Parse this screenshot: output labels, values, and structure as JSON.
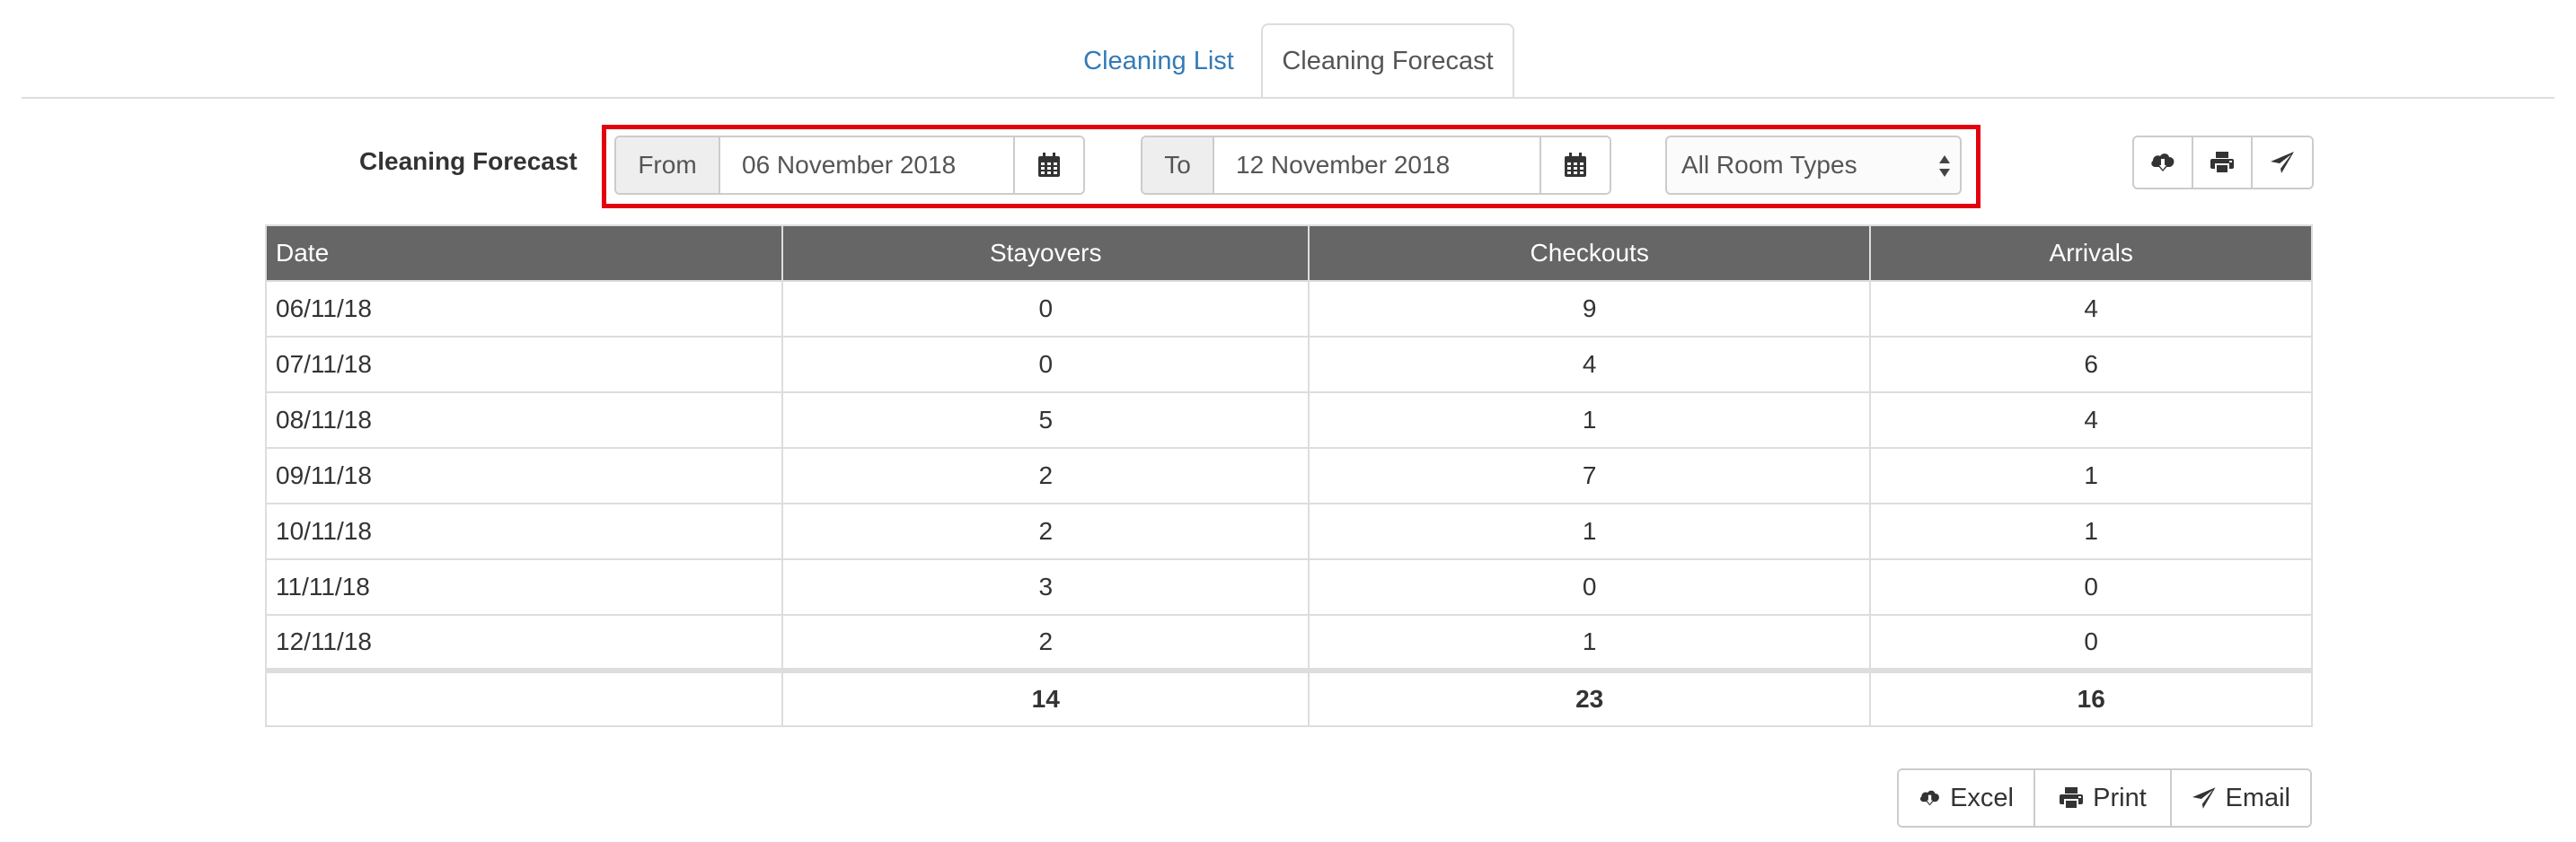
{
  "tabs": [
    {
      "label": "Cleaning List"
    },
    {
      "label": "Cleaning Forecast"
    }
  ],
  "filter": {
    "title": "Cleaning Forecast",
    "from_label": "From",
    "from_value": "06 November 2018",
    "to_label": "To",
    "to_value": "12 November 2018",
    "room_type_value": "All Room Types"
  },
  "table": {
    "headers": [
      "Date",
      "Stayovers",
      "Checkouts",
      "Arrivals"
    ],
    "rows": [
      [
        "06/11/18",
        "0",
        "9",
        "4"
      ],
      [
        "07/11/18",
        "0",
        "4",
        "6"
      ],
      [
        "08/11/18",
        "5",
        "1",
        "4"
      ],
      [
        "09/11/18",
        "2",
        "7",
        "1"
      ],
      [
        "10/11/18",
        "2",
        "1",
        "1"
      ],
      [
        "11/11/18",
        "3",
        "0",
        "0"
      ],
      [
        "12/11/18",
        "2",
        "1",
        "0"
      ]
    ],
    "totals": [
      "",
      "14",
      "23",
      "16"
    ]
  },
  "actions": {
    "excel_label": "Excel",
    "print_label": "Print",
    "email_label": "Email"
  },
  "colors": {
    "link": "#337ab7",
    "header_bg": "#666666",
    "highlight": "#e3000f"
  }
}
